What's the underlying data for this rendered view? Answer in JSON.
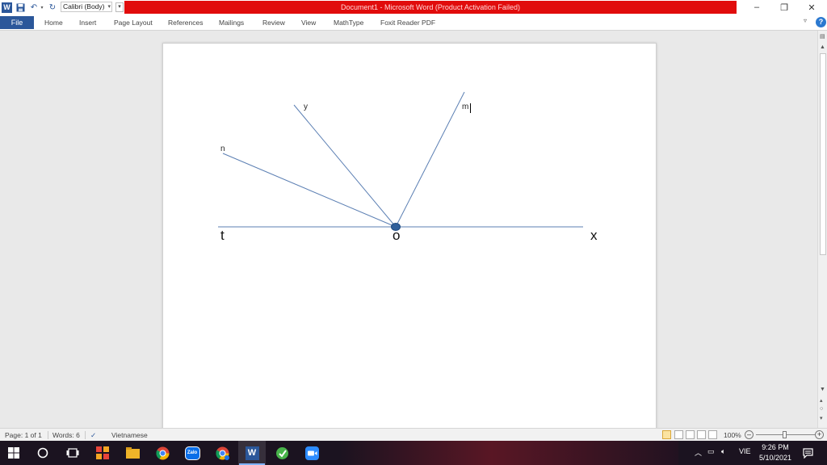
{
  "window": {
    "title": "Document1  -  Microsoft Word (Product Activation Failed)",
    "font_name": "Calibri (Body)",
    "controls": {
      "minimize": "–",
      "restore": "❐",
      "close": "✕"
    },
    "title_bar_color": "#e10c0c"
  },
  "ribbon": {
    "file_tab": "File",
    "tabs": [
      "Home",
      "Insert",
      "Page Layout",
      "References",
      "Mailings",
      "Review",
      "View",
      "MathType",
      "Foxit Reader PDF"
    ],
    "accent": "#2b579a"
  },
  "document": {
    "labels": {
      "y": "y",
      "m": "m",
      "n": "n",
      "t": "t",
      "o": "o",
      "x": "x"
    },
    "line_color": "#5b7fb3",
    "point_color": "#2f5f9b"
  },
  "statusbar": {
    "page": "Page: 1 of 1",
    "words": "Words: 6",
    "language": "Vietnamese",
    "zoom": "100%",
    "zoom_minus": "–",
    "zoom_plus": "+"
  },
  "taskbar": {
    "apps": [
      "windows-start",
      "search",
      "task-view",
      "app-tiles",
      "file-explorer",
      "chrome",
      "zalo",
      "chrome-profile",
      "word",
      "app-green",
      "zoom"
    ],
    "zalo_label": "Zalo",
    "word_label": "W",
    "tray_language": "VIE",
    "time": "9:26 PM",
    "date": "5/10/2021"
  }
}
